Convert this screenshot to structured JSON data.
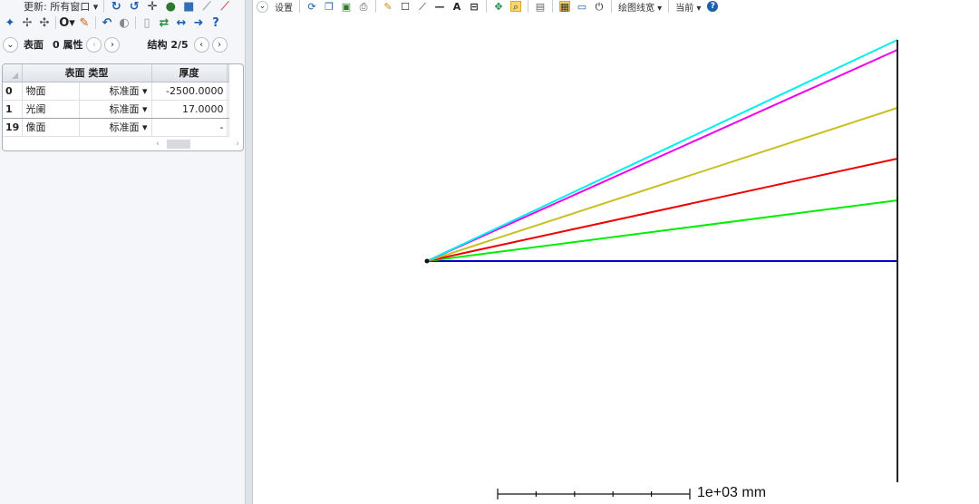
{
  "left_toolbar": {
    "update_label": "更新: 所有窗口 ▾"
  },
  "nav": {
    "surface_label": "表面",
    "properties_label": "0 属性",
    "config_label": "结构 2/5"
  },
  "lens_table": {
    "headers": {
      "surface_type": "表面 类型",
      "thickness": "厚度"
    },
    "rows": [
      {
        "num": "0",
        "name": "物面",
        "type": "标准面 ▾",
        "thickness": "-2500.0000"
      },
      {
        "num": "1",
        "name": "光阑",
        "type": "标准面 ▾",
        "thickness": "17.0000"
      },
      {
        "num": "19",
        "name": "像面",
        "type": "标准面 ▾",
        "thickness": "-"
      }
    ]
  },
  "right_toolbar": {
    "settings_label": "设置",
    "line_width_label": "绘图线宽 ▾",
    "current_label": "当前 ▾"
  },
  "layout_plot": {
    "scale_label": "1e+03 mm",
    "ray_colors": [
      "#0000cc",
      "#00ee00",
      "#ee0000",
      "#c8c020",
      "#ee00ee",
      "#00eeee"
    ]
  }
}
